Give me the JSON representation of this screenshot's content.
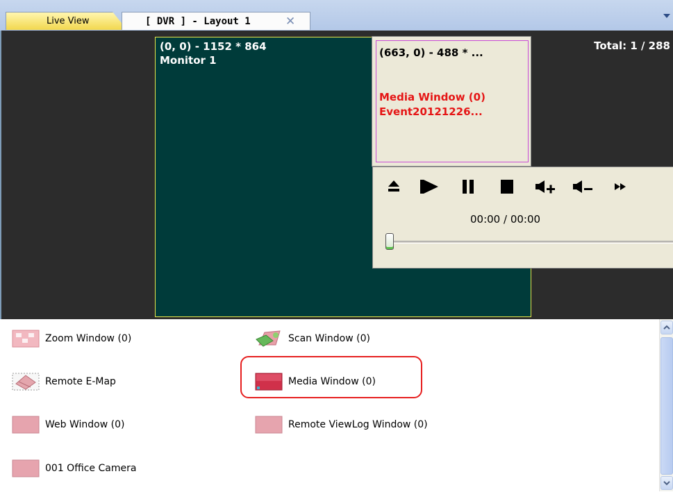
{
  "tabs": [
    {
      "label": "Live View"
    },
    {
      "label": "[ DVR ] - Layout 1"
    }
  ],
  "monitor": {
    "resolution": "(0, 0) - 1152 * 864",
    "name": "Monitor 1",
    "color": "#003b3a",
    "border_color": "#e8e54a"
  },
  "total": "Total: 1 / 288",
  "media_window": {
    "resolution": "(663, 0) - 488 * ...",
    "title": "Media Window (0)",
    "event": "Event20121226...",
    "title_color": "#e51515"
  },
  "player": {
    "controls": [
      "eject-icon",
      "play-icon",
      "pause-icon",
      "stop-icon",
      "volume-up-icon",
      "volume-down-icon",
      "fast-forward-icon"
    ],
    "time": "00:00  /  00:00",
    "progress": 0
  },
  "objects": [
    {
      "label": "Zoom Window (0)",
      "icon": "zoom-window-icon"
    },
    {
      "label": "Scan Window (0)",
      "icon": "scan-window-icon"
    },
    {
      "label": "Remote E-Map",
      "icon": "remote-emap-icon"
    },
    {
      "label": "Media Window (0)",
      "icon": "media-window-icon"
    },
    {
      "label": "Web Window (0)",
      "icon": "web-window-icon"
    },
    {
      "label": "Remote ViewLog Window (0)",
      "icon": "remote-viewlog-icon"
    },
    {
      "label": "001 Office Camera",
      "icon": "camera-icon"
    }
  ],
  "highlight_color": "#e61e1e"
}
